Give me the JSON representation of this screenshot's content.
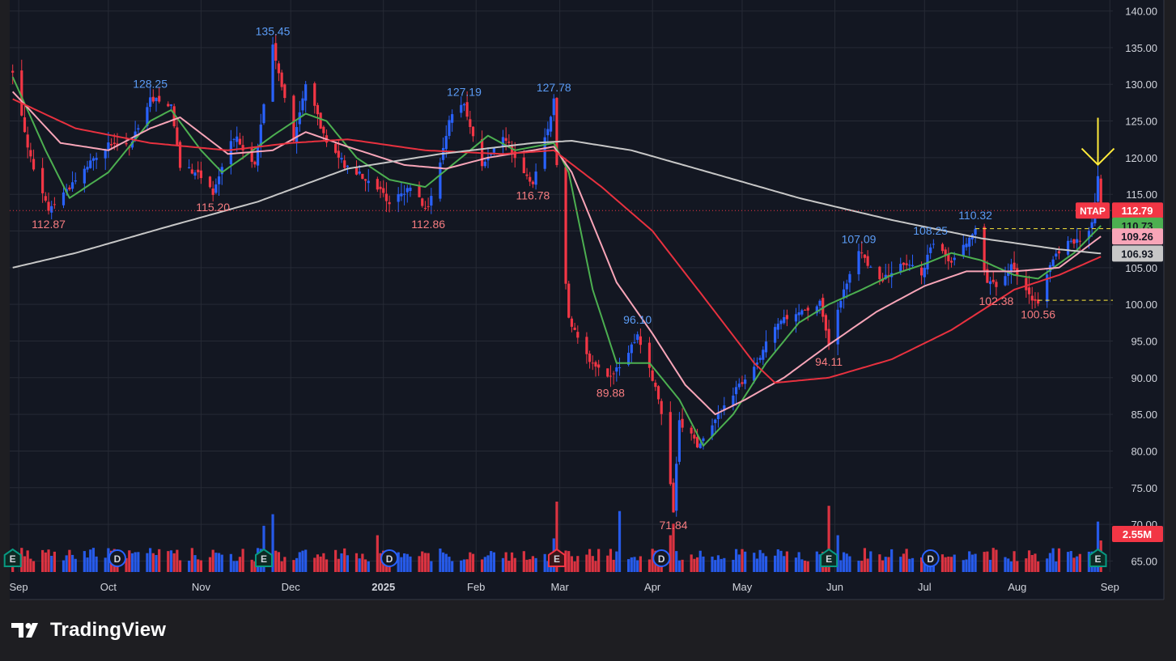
{
  "app": {
    "brand": "TradingView"
  },
  "colors": {
    "background": "#131722",
    "frame": "#1e1e22",
    "grid": "#262a35",
    "up": "#2962ff",
    "down": "#f23645",
    "sma10": "#4caf50",
    "sma21": "#f8a5b8",
    "sma50": "#e8313f",
    "sma200": "#c7c7c7",
    "axis_text": "#d1d4dc",
    "annotation": "#ffeb3b"
  },
  "chart_data": {
    "type": "candlestick",
    "symbol": "NTAP",
    "y_range": [
      63.5,
      141.5
    ],
    "y_ticks": [
      "140.00",
      "135.00",
      "130.00",
      "125.00",
      "120.00",
      "115.00",
      "110.00",
      "105.00",
      "100.00",
      "95.00",
      "90.00",
      "85.00",
      "80.00",
      "75.00",
      "70.00",
      "65.00"
    ],
    "x_range": [
      "2024-08-29",
      "2025-09-02"
    ],
    "x_ticks": [
      {
        "date": "2024-09-01",
        "label": "Sep"
      },
      {
        "date": "2024-10-01",
        "label": "Oct"
      },
      {
        "date": "2024-11-01",
        "label": "Nov"
      },
      {
        "date": "2024-12-01",
        "label": "Dec"
      },
      {
        "date": "2025-01-01",
        "label": "2025"
      },
      {
        "date": "2025-02-01",
        "label": "Feb"
      },
      {
        "date": "2025-03-01",
        "label": "Mar"
      },
      {
        "date": "2025-04-01",
        "label": "Apr"
      },
      {
        "date": "2025-05-01",
        "label": "May"
      },
      {
        "date": "2025-06-01",
        "label": "Jun"
      },
      {
        "date": "2025-07-01",
        "label": "Jul"
      },
      {
        "date": "2025-08-01",
        "label": "Aug"
      },
      {
        "date": "2025-09-01",
        "label": "Sep"
      }
    ],
    "price_path": [
      [
        "2024-08-30",
        131.5
      ],
      [
        "2024-09-06",
        118
      ],
      [
        "2024-09-11",
        112.87
      ],
      [
        "2024-09-20",
        117
      ],
      [
        "2024-10-01",
        122
      ],
      [
        "2024-10-08",
        121.5
      ],
      [
        "2024-10-15",
        128.25
      ],
      [
        "2024-10-22",
        127
      ],
      [
        "2024-10-25",
        119
      ],
      [
        "2024-10-31",
        118
      ],
      [
        "2024-11-05",
        115.2
      ],
      [
        "2024-11-12",
        123
      ],
      [
        "2024-11-19",
        119
      ],
      [
        "2024-11-25",
        135.45
      ],
      [
        "2024-12-02",
        122
      ],
      [
        "2024-12-06",
        130
      ],
      [
        "2024-12-13",
        122
      ],
      [
        "2024-12-19",
        119
      ],
      [
        "2024-12-27",
        117
      ],
      [
        "2025-01-03",
        114
      ],
      [
        "2025-01-10",
        116
      ],
      [
        "2025-01-16",
        112.86
      ],
      [
        "2025-01-23",
        125
      ],
      [
        "2025-01-28",
        127.19
      ],
      [
        "2025-02-03",
        119
      ],
      [
        "2025-02-10",
        123
      ],
      [
        "2025-02-17",
        118
      ],
      [
        "2025-02-20",
        116.78
      ],
      [
        "2025-02-25",
        124
      ],
      [
        "2025-02-27",
        127.78
      ],
      [
        "2025-02-28",
        119
      ],
      [
        "2025-03-04",
        98
      ],
      [
        "2025-03-10",
        93
      ],
      [
        "2025-03-14",
        91
      ],
      [
        "2025-03-18",
        89.88
      ],
      [
        "2025-03-24",
        93.5
      ],
      [
        "2025-03-27",
        96.1
      ],
      [
        "2025-04-01",
        90
      ],
      [
        "2025-04-04",
        85
      ],
      [
        "2025-04-08",
        71.84
      ],
      [
        "2025-04-10",
        84
      ],
      [
        "2025-04-16",
        81
      ],
      [
        "2025-04-22",
        84
      ],
      [
        "2025-04-28",
        88
      ],
      [
        "2025-05-05",
        91
      ],
      [
        "2025-05-12",
        97
      ],
      [
        "2025-05-19",
        99
      ],
      [
        "2025-05-27",
        100
      ],
      [
        "2025-05-30",
        94.11
      ],
      [
        "2025-06-04",
        102
      ],
      [
        "2025-06-09",
        107.09
      ],
      [
        "2025-06-16",
        103
      ],
      [
        "2025-06-23",
        106
      ],
      [
        "2025-06-30",
        104
      ],
      [
        "2025-07-03",
        108.25
      ],
      [
        "2025-07-10",
        106
      ],
      [
        "2025-07-18",
        110.32
      ],
      [
        "2025-07-22",
        103
      ],
      [
        "2025-07-25",
        102.38
      ],
      [
        "2025-07-30",
        105.5
      ],
      [
        "2025-08-05",
        101
      ],
      [
        "2025-08-08",
        100.56
      ],
      [
        "2025-08-13",
        106
      ],
      [
        "2025-08-18",
        108.5
      ],
      [
        "2025-08-22",
        109
      ],
      [
        "2025-08-26",
        111
      ],
      [
        "2025-08-28",
        117.5
      ],
      [
        "2025-08-29",
        112.79
      ]
    ],
    "volume_scale_max": 7.7,
    "volume_spikes": [
      [
        "2024-09-26",
        2.3
      ],
      [
        "2024-11-22",
        4.4
      ],
      [
        "2024-11-25",
        5.5
      ],
      [
        "2024-12-30",
        3.5
      ],
      [
        "2025-02-27",
        3.2
      ],
      [
        "2025-02-28",
        6.7
      ],
      [
        "2025-03-21",
        5.8
      ],
      [
        "2025-04-07",
        3.5
      ],
      [
        "2025-04-08",
        4.6
      ],
      [
        "2025-05-30",
        6.3
      ],
      [
        "2025-06-02",
        3.5
      ],
      [
        "2025-08-28",
        4.8
      ],
      [
        "2025-08-29",
        3.0
      ]
    ],
    "high_labels": [
      {
        "date": "2024-10-15",
        "value": "128.25"
      },
      {
        "date": "2024-11-25",
        "value": "135.45"
      },
      {
        "date": "2025-01-28",
        "value": "127.19"
      },
      {
        "date": "2025-02-27",
        "value": "127.78"
      },
      {
        "date": "2025-03-27",
        "value": "96.10"
      },
      {
        "date": "2025-06-09",
        "value": "107.09"
      },
      {
        "date": "2025-07-03",
        "value": "108.25"
      },
      {
        "date": "2025-07-18",
        "value": "110.32"
      }
    ],
    "low_labels": [
      {
        "date": "2024-09-11",
        "value": "112.87"
      },
      {
        "date": "2024-11-05",
        "value": "115.20"
      },
      {
        "date": "2025-01-16",
        "value": "112.86"
      },
      {
        "date": "2025-02-20",
        "value": "116.78"
      },
      {
        "date": "2025-03-18",
        "value": "89.88"
      },
      {
        "date": "2025-04-08",
        "value": "71.84"
      },
      {
        "date": "2025-05-30",
        "value": "94.11"
      },
      {
        "date": "2025-07-25",
        "value": "102.38"
      },
      {
        "date": "2025-08-08",
        "value": "100.56"
      }
    ],
    "sma": [
      {
        "period": 10,
        "color": "#4caf50",
        "points": [
          [
            "2024-08-30",
            131
          ],
          [
            "2024-09-10",
            121
          ],
          [
            "2024-09-18",
            114.5
          ],
          [
            "2024-10-01",
            118
          ],
          [
            "2024-10-15",
            125
          ],
          [
            "2024-10-22",
            126.5
          ],
          [
            "2024-11-01",
            121
          ],
          [
            "2024-11-08",
            118
          ],
          [
            "2024-11-15",
            120
          ],
          [
            "2024-11-25",
            123
          ],
          [
            "2024-12-06",
            126
          ],
          [
            "2024-12-13",
            125
          ],
          [
            "2024-12-23",
            120
          ],
          [
            "2025-01-03",
            117
          ],
          [
            "2025-01-15",
            116
          ],
          [
            "2025-01-27",
            120
          ],
          [
            "2025-02-05",
            123
          ],
          [
            "2025-02-14",
            121
          ],
          [
            "2025-02-27",
            122
          ],
          [
            "2025-03-04",
            118
          ],
          [
            "2025-03-12",
            102
          ],
          [
            "2025-03-20",
            92
          ],
          [
            "2025-03-31",
            92
          ],
          [
            "2025-04-10",
            87
          ],
          [
            "2025-04-18",
            80.7
          ],
          [
            "2025-04-28",
            85
          ],
          [
            "2025-05-09",
            92
          ],
          [
            "2025-05-20",
            97.5
          ],
          [
            "2025-05-30",
            100
          ],
          [
            "2025-06-10",
            102
          ],
          [
            "2025-06-20",
            104
          ],
          [
            "2025-07-01",
            105.5
          ],
          [
            "2025-07-10",
            107
          ],
          [
            "2025-07-20",
            106
          ],
          [
            "2025-07-31",
            104
          ],
          [
            "2025-08-08",
            103.5
          ],
          [
            "2025-08-20",
            107
          ],
          [
            "2025-08-29",
            110.73
          ]
        ]
      },
      {
        "period": 21,
        "color": "#f8a5b8",
        "points": [
          [
            "2024-08-30",
            129
          ],
          [
            "2024-09-15",
            122
          ],
          [
            "2024-10-01",
            121
          ],
          [
            "2024-10-15",
            124
          ],
          [
            "2024-10-25",
            125.5
          ],
          [
            "2024-11-10",
            120.5
          ],
          [
            "2024-11-25",
            121
          ],
          [
            "2024-12-06",
            123.5
          ],
          [
            "2024-12-20",
            121.5
          ],
          [
            "2025-01-08",
            119
          ],
          [
            "2025-01-22",
            118.5
          ],
          [
            "2025-02-05",
            120
          ],
          [
            "2025-02-20",
            121
          ],
          [
            "2025-02-27",
            121.5
          ],
          [
            "2025-03-05",
            118
          ],
          [
            "2025-03-20",
            103
          ],
          [
            "2025-04-01",
            96
          ],
          [
            "2025-04-12",
            89
          ],
          [
            "2025-04-22",
            85
          ],
          [
            "2025-05-02",
            87
          ],
          [
            "2025-05-15",
            90
          ],
          [
            "2025-05-30",
            94.5
          ],
          [
            "2025-06-15",
            99
          ],
          [
            "2025-07-01",
            102.5
          ],
          [
            "2025-07-15",
            104.5
          ],
          [
            "2025-07-31",
            104.5
          ],
          [
            "2025-08-15",
            105
          ],
          [
            "2025-08-29",
            109.26
          ]
        ]
      },
      {
        "period": 50,
        "color": "#e8313f",
        "points": [
          [
            "2024-08-30",
            128
          ],
          [
            "2024-09-20",
            124
          ],
          [
            "2024-10-15",
            122
          ],
          [
            "2024-11-10",
            121
          ],
          [
            "2024-12-01",
            122
          ],
          [
            "2024-12-20",
            122.5
          ],
          [
            "2025-01-15",
            121
          ],
          [
            "2025-02-10",
            120.5
          ],
          [
            "2025-02-27",
            121
          ],
          [
            "2025-03-15",
            116
          ],
          [
            "2025-04-01",
            110
          ],
          [
            "2025-04-20",
            100
          ],
          [
            "2025-05-05",
            92
          ],
          [
            "2025-05-12",
            89.3
          ],
          [
            "2025-05-30",
            90
          ],
          [
            "2025-06-20",
            92.5
          ],
          [
            "2025-07-10",
            96.5
          ],
          [
            "2025-07-31",
            102
          ],
          [
            "2025-08-15",
            104
          ],
          [
            "2025-08-29",
            106.5
          ]
        ]
      },
      {
        "period": 200,
        "color": "#c7c7c7",
        "points": [
          [
            "2024-08-30",
            105
          ],
          [
            "2024-09-20",
            107
          ],
          [
            "2024-10-20",
            110.5
          ],
          [
            "2024-11-20",
            114
          ],
          [
            "2024-12-20",
            118.5
          ],
          [
            "2025-01-20",
            120.5
          ],
          [
            "2025-02-20",
            122
          ],
          [
            "2025-03-05",
            122.3
          ],
          [
            "2025-03-25",
            121
          ],
          [
            "2025-04-20",
            118
          ],
          [
            "2025-05-20",
            114.5
          ],
          [
            "2025-06-20",
            111.5
          ],
          [
            "2025-07-20",
            109
          ],
          [
            "2025-08-15",
            107.5
          ],
          [
            "2025-08-29",
            106.93
          ]
        ]
      }
    ],
    "price_line": {
      "value": 112.79
    },
    "dashed_levels": [
      {
        "value": 110.32,
        "from": "2025-07-18"
      },
      {
        "value": 100.56,
        "from": "2025-08-08"
      }
    ],
    "markers": [
      {
        "date": "2024-08-30",
        "letter": "E",
        "kind": "earnings-up"
      },
      {
        "date": "2024-10-04",
        "letter": "D",
        "kind": "dividend"
      },
      {
        "date": "2024-11-22",
        "letter": "E",
        "kind": "earnings-up"
      },
      {
        "date": "2025-01-03",
        "letter": "D",
        "kind": "dividend"
      },
      {
        "date": "2025-02-28",
        "letter": "E",
        "kind": "earnings-down"
      },
      {
        "date": "2025-04-04",
        "letter": "D",
        "kind": "dividend"
      },
      {
        "date": "2025-05-30",
        "letter": "E",
        "kind": "earnings-up"
      },
      {
        "date": "2025-07-03",
        "letter": "D",
        "kind": "dividend"
      },
      {
        "date": "2025-08-28",
        "letter": "E",
        "kind": "earnings-up"
      }
    ],
    "axis_badges": [
      {
        "value": 112.79,
        "text": "112.79",
        "bg": "#f23645",
        "fg": "#ffffff",
        "label": "NTAP"
      },
      {
        "value": 110.73,
        "text": "110.73",
        "bg": "#4caf50",
        "fg": "#131722"
      },
      {
        "value": 109.26,
        "text": "109.26",
        "bg": "#f8a5b8",
        "fg": "#131722"
      },
      {
        "value": 106.93,
        "text": "106.93",
        "bg": "#c7c7c7",
        "fg": "#131722"
      }
    ],
    "volume_badge": {
      "text": "2.55M",
      "bg": "#f23645"
    },
    "annotation_arrow": {
      "date": "2025-08-28",
      "value": 117.5,
      "color": "#ffeb3b"
    }
  }
}
